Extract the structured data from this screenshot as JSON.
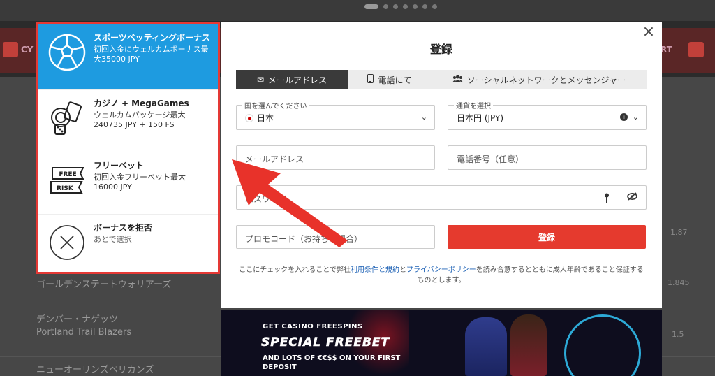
{
  "background": {
    "left_top_label": "CY",
    "right_top_label": "RT",
    "teams": [
      "ゴールデンステートウォリアーズ",
      "デンバー・ナゲッツ",
      "Portland Trail Blazers",
      "ニューオーリンズペリカンズ"
    ],
    "odds": [
      "1.87",
      "1.845",
      "1.5"
    ]
  },
  "bonus_panel": {
    "items": [
      {
        "title": "スポーツベッティングボーナス",
        "desc": "初回入金にウェルカムボーナス最大35000 JPY",
        "icon": "soccer-ball-icon"
      },
      {
        "title": "カジノ + MegaGames",
        "desc": "ウェルカムパッケージ最大 240735 JPY + 150 FS",
        "icon": "casino-chips-dice-icon"
      },
      {
        "title": "フリーベット",
        "desc": "初回入金フリーベット最大 16000 JPY",
        "icon": "free-risk-ticket-icon",
        "icon_text_1": "FREE",
        "icon_text_2": "RISK"
      },
      {
        "title": "ボーナスを拒否",
        "desc": "あとで選択",
        "icon": "decline-x-icon"
      }
    ]
  },
  "modal": {
    "title": "登録",
    "close_label": "×",
    "tabs": [
      {
        "label": "メールアドレス",
        "icon": "envelope-icon"
      },
      {
        "label": "電話にて",
        "icon": "phone-icon"
      },
      {
        "label": "ソーシャルネットワークとメッセンジャー",
        "icon": "users-icon"
      }
    ],
    "country": {
      "label": "国を選んでください",
      "value": "日本"
    },
    "currency": {
      "label": "通貨を選択",
      "value": "日本円 (JPY)"
    },
    "email_placeholder": "メールアドレス",
    "phone_placeholder": "電話番号（任意）",
    "password_placeholder": "パスワード",
    "promo_placeholder": "プロモコード（お持ちの場合）",
    "register_label": "登録",
    "terms": {
      "prefix": "ここにチェックを入れることで弊社",
      "link1": "利用条件と規約",
      "mid": "と",
      "link2": "プライバシーポリシー",
      "suffix": "を読み合意するとともに成人年齢であること保証するものとします。"
    }
  },
  "banner": {
    "line1": "GET CASINO FREESPINS",
    "line2": "SPECIAL FREEBET",
    "line3": "AND LOTS OF €€$$ ON YOUR FIRST DEPOSIT"
  },
  "colors": {
    "accent_red": "#e53a2e",
    "selected_blue": "#1e9be0",
    "highlight_border": "#e53935"
  }
}
